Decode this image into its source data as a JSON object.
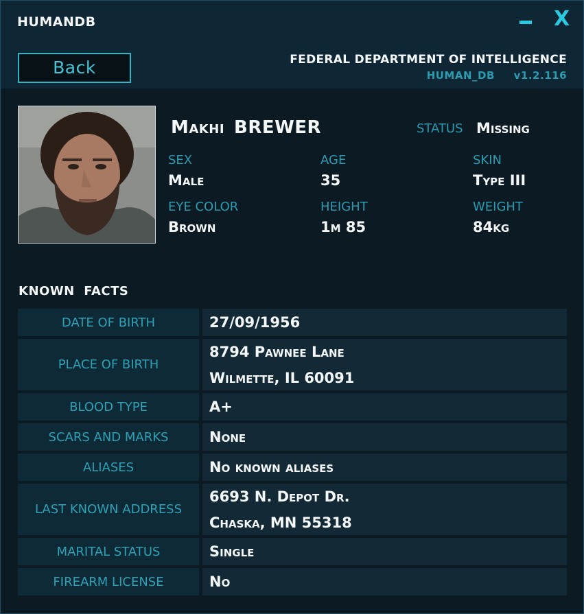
{
  "window": {
    "title": "HUMANDB",
    "minimize_label": "",
    "close_label": "X"
  },
  "header": {
    "back_label": "Back",
    "agency": "FEDERAL DEPARTMENT OF INTELLIGENCE",
    "db_name": "HUMAN_DB",
    "version": "v1.2.116"
  },
  "profile": {
    "first_name": "Makhi",
    "last_name": "BREWER",
    "status_label": "STATUS",
    "status_value": "Missing",
    "attributes": [
      {
        "label": "SEX",
        "value": "Male"
      },
      {
        "label": "AGE",
        "value": "35"
      },
      {
        "label": "SKIN",
        "value": "Type III"
      },
      {
        "label": "EYE COLOR",
        "value": "Brown"
      },
      {
        "label": "HEIGHT",
        "value": "1m 85"
      },
      {
        "label": "WEIGHT",
        "value": "84kg"
      }
    ]
  },
  "facts": {
    "title": "KNOWN  FACTS",
    "rows": [
      {
        "label": "DATE OF BIRTH",
        "lines": [
          "27/09/1956"
        ]
      },
      {
        "label": "PLACE OF BIRTH",
        "lines": [
          "8794 Pawnee Lane",
          "Wilmette, IL 60091"
        ]
      },
      {
        "label": "BLOOD TYPE",
        "lines": [
          "A+"
        ]
      },
      {
        "label": "SCARS AND MARKS",
        "lines": [
          "None"
        ]
      },
      {
        "label": "ALIASES",
        "lines": [
          "No known aliases"
        ]
      },
      {
        "label": "LAST KNOWN ADDRESS",
        "lines": [
          "6693 N. Depot Dr.",
          "Chaska, MN 55318"
        ]
      },
      {
        "label": "MARITAL STATUS",
        "lines": [
          "Single"
        ]
      },
      {
        "label": "FIREARM LICENSE",
        "lines": [
          "No"
        ]
      }
    ]
  },
  "colors": {
    "accent": "#29c9e0",
    "label": "#2b9cb0",
    "background": "#0c1a24"
  }
}
